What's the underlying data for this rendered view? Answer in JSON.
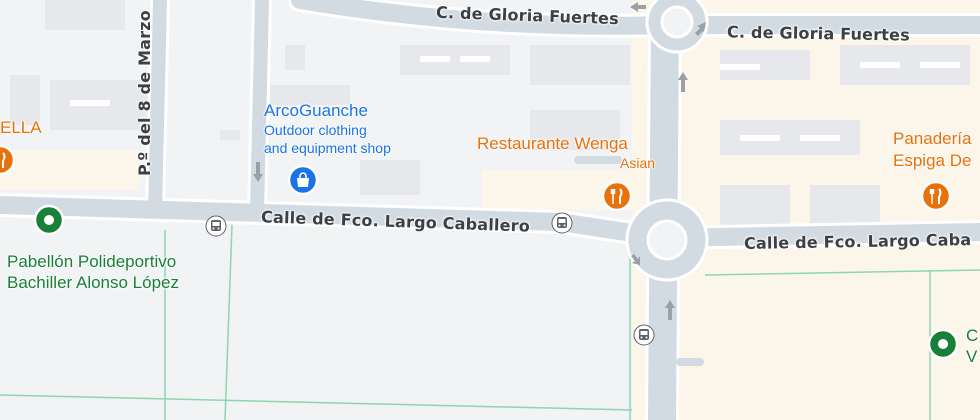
{
  "streets": {
    "gloria_left": "C. de Gloria Fuertes",
    "gloria_right": "C. de Gloria Fuertes",
    "marzo": "P.º del 8 de Marzo",
    "largo_left": "Calle de Fco. Largo Caballero",
    "largo_right": "Calle de Fco. Largo Caba"
  },
  "pois": {
    "arcoguanche": {
      "name": "ArcoGuanche",
      "line1": "Outdoor clothing",
      "line2": "and equipment shop",
      "icon": "shopping-bag-icon"
    },
    "wenga": {
      "name": "Restaurante Wenga",
      "sub": "Asian",
      "icon": "fork-knife-icon"
    },
    "panaderia": {
      "line1": "Panadería",
      "line2": "Espiga De",
      "icon": "fork-knife-icon"
    },
    "pabellon": {
      "line1": "Pabellón Polideportivo",
      "line2": "Bachiller Alonso López",
      "icon": "park-icon"
    },
    "ella": {
      "name": "ELLA",
      "icon": "fork-knife-icon"
    },
    "c_right": {
      "line1": "C",
      "line2": "V",
      "icon": "park-icon"
    }
  },
  "colors": {
    "road": "#d2dbe2",
    "road_edge": "#ffffff",
    "building": "#e8eaed",
    "land": "#f1f3f4",
    "beige": "#fbf6e9",
    "park_line": "#8ed6b0",
    "blue_poi": "#1a73e8",
    "orange_poi": "#e8710a",
    "green_poi": "#188038"
  }
}
